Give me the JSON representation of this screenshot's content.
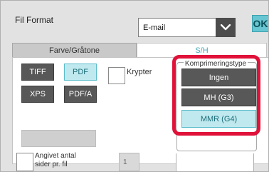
{
  "header": {
    "title": "Fil Format",
    "format_select": {
      "value": "E-mail"
    },
    "ok_label": "OK"
  },
  "tabs": [
    {
      "label": "Farve/Gråtone",
      "active": false
    },
    {
      "label": "S/H",
      "active": true
    }
  ],
  "file_formats": [
    {
      "label": "TIFF",
      "selected": false
    },
    {
      "label": "PDF",
      "selected": true
    },
    {
      "label": "XPS",
      "selected": false
    },
    {
      "label": "PDF/A",
      "selected": false
    }
  ],
  "encrypt": {
    "label": "Krypter",
    "checked": false
  },
  "compression": {
    "title": "Komprimeringstype",
    "options": [
      {
        "label": "Ingen",
        "selected": false
      },
      {
        "label": "MH (G3)",
        "selected": false
      },
      {
        "label": "MMR (G4)",
        "selected": true
      }
    ]
  },
  "pages_per_file": {
    "label": "Angivet antal sider pr. fil",
    "checked": false,
    "value": "1"
  },
  "colors": {
    "accent": "#67c6d2",
    "selected_bg": "#bfe9ef",
    "unselected_bg": "#585858",
    "highlight": "#e0123a"
  },
  "icons": {
    "dropdown": "chevron-down-icon"
  }
}
